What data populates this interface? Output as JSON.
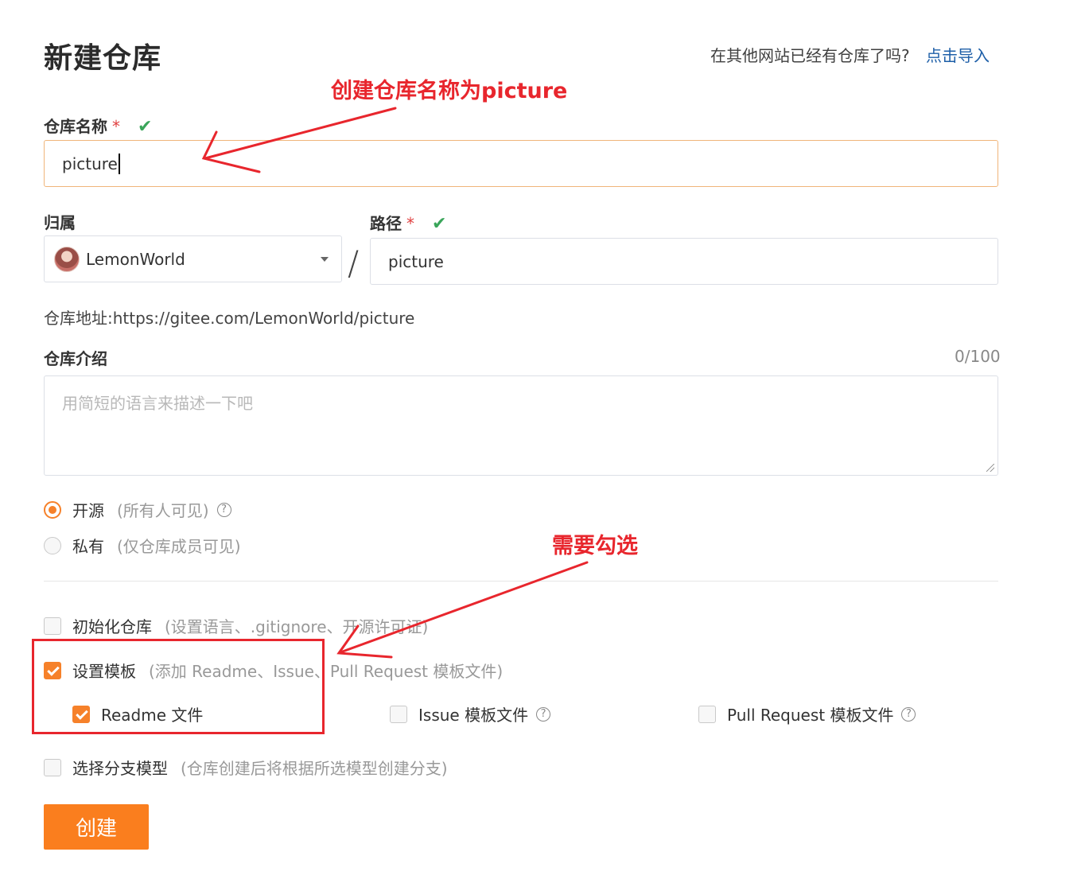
{
  "header": {
    "title": "新建仓库",
    "import_prompt": "在其他网站已经有仓库了吗?",
    "import_link": "点击导入"
  },
  "form": {
    "repo_name": {
      "label": "仓库名称",
      "required_mark": "*",
      "value": "picture"
    },
    "owner": {
      "label": "归属",
      "value": "LemonWorld"
    },
    "separator": "/",
    "path": {
      "label": "路径",
      "required_mark": "*",
      "value": "picture"
    },
    "address": {
      "label": "仓库地址:",
      "value": "https://gitee.com/LemonWorld/picture"
    },
    "description": {
      "label": "仓库介绍",
      "counter": "0/100",
      "placeholder": "用简短的语言来描述一下吧"
    },
    "visibility": [
      {
        "label": "开源",
        "hint": "(所有人可见)",
        "selected": true
      },
      {
        "label": "私有",
        "hint": "(仅仓库成员可见)",
        "selected": false
      }
    ],
    "init_repo": {
      "label": "初始化仓库",
      "hint": "(设置语言、.gitignore、开源许可证)",
      "checked": false
    },
    "templates": {
      "label": "设置模板",
      "hint": "(添加 Readme、Issue、Pull Request 模板文件)",
      "checked": true
    },
    "template_options": [
      {
        "label": "Readme 文件",
        "checked": true
      },
      {
        "label": "Issue 模板文件",
        "checked": false
      },
      {
        "label": "Pull Request 模板文件",
        "checked": false
      }
    ],
    "branch_model": {
      "label": "选择分支模型",
      "hint": "(仓库创建后将根据所选模型创建分支)",
      "checked": false
    },
    "submit_label": "创建"
  },
  "annotations": {
    "name_note": "创建仓库名称为picture",
    "check_note": "需要勾选",
    "color": "#e8262d"
  },
  "colors": {
    "accent": "#fa7e1e",
    "link": "#1e5fa8",
    "valid": "#3aa55a"
  }
}
